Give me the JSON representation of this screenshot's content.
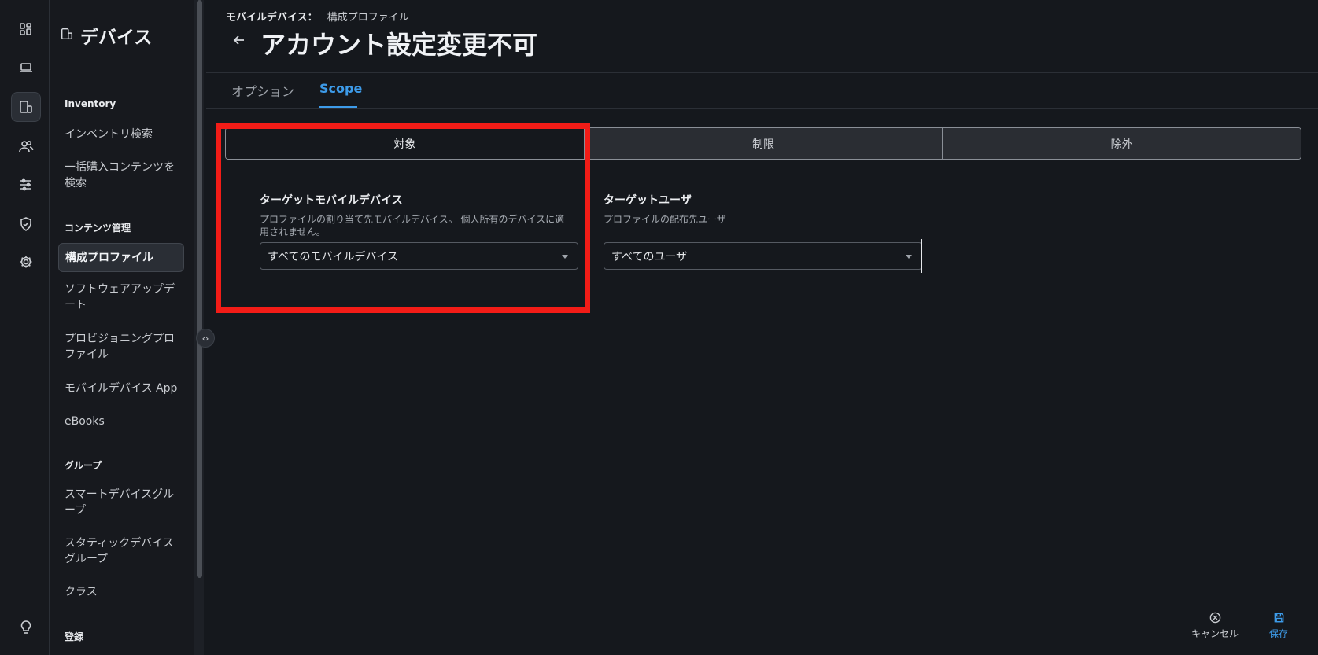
{
  "rail": {
    "items": [
      {
        "icon": "dashboard-icon",
        "active": false
      },
      {
        "icon": "laptop-icon",
        "active": false
      },
      {
        "icon": "mobile-devices-icon",
        "active": true
      },
      {
        "icon": "users-icon",
        "active": false
      },
      {
        "icon": "sliders-icon",
        "active": false
      },
      {
        "icon": "shield-check-icon",
        "active": false
      },
      {
        "icon": "gear-icon",
        "active": false
      },
      {
        "icon": "lightbulb-icon",
        "active": false
      }
    ]
  },
  "sidebar": {
    "title": "デバイス",
    "sections": {
      "inventory": "Inventory",
      "content": "コンテンツ管理",
      "groups": "グループ",
      "enrollment": "登録"
    },
    "items": {
      "inventory_search": "インベントリ検索",
      "vpp_search": "一括購入コンテンツを検索",
      "config_profiles": "構成プロファイル",
      "software_update": "ソフトウェアアップデート",
      "provisioning": "プロビジョニングプロファイル",
      "mobile_apps": "モバイルデバイス App",
      "ebooks": "eBooks",
      "smart_groups": "スマートデバイスグループ",
      "static_groups": "スタティックデバイスグループ",
      "classes": "クラス"
    },
    "collapse_symbol": "‹›"
  },
  "header": {
    "breadcrumb_parent": "モバイルデバイス：",
    "breadcrumb_current": "構成プロファイル",
    "title": "アカウント設定変更不可"
  },
  "tabs": {
    "options": "オプション",
    "scope": "Scope",
    "active": "scope"
  },
  "segments": {
    "target": "対象",
    "limitations": "制限",
    "exclusions": "除外"
  },
  "target_devices": {
    "label": "ターゲットモバイルデバイス",
    "description": "プロファイルの割り当て先モバイルデバイス。 個人所有のデバイスに適用されません。",
    "value": "すべてのモバイルデバイス"
  },
  "target_users": {
    "label": "ターゲットユーザ",
    "description": "プロファイルの配布先ユーザ",
    "value": "すべてのユーザ"
  },
  "footer": {
    "cancel": "キャンセル",
    "save": "保存"
  },
  "colors": {
    "accent": "#3d9be9",
    "highlight": "#f21c17",
    "background": "#15181d"
  }
}
